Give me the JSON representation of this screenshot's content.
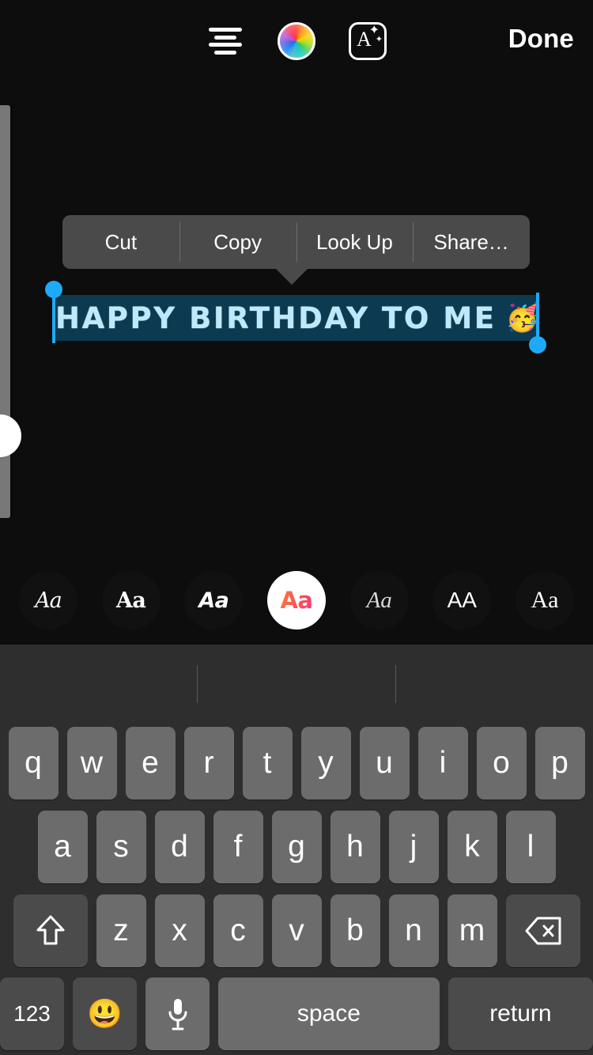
{
  "toolbar": {
    "align_icon": "text-align-center-icon",
    "color_icon": "color-wheel-icon",
    "effects_icon": "text-effects-icon",
    "effects_letter": "A",
    "done_label": "Done"
  },
  "edit_menu": {
    "items": [
      {
        "label": "Cut",
        "name": "cut"
      },
      {
        "label": "Copy",
        "name": "copy"
      },
      {
        "label": "Look Up",
        "name": "look-up"
      },
      {
        "label": "Share…",
        "name": "share"
      }
    ]
  },
  "text_overlay": {
    "text": "HAPPY BIRTHDAY TO ME",
    "emoji": "🥳",
    "text_color": "#bfe9fb",
    "selection_color": "#0c3a50",
    "handle_color": "#1eaaf8",
    "selected": true
  },
  "font_picker": {
    "items": [
      {
        "label": "Aa",
        "style": "script",
        "selected": false
      },
      {
        "label": "Aa",
        "style": "slab-bold",
        "selected": false
      },
      {
        "label": "Aa",
        "style": "bold-italic",
        "selected": false
      },
      {
        "label": "Aa",
        "style": "rounded-gradient",
        "selected": true
      },
      {
        "label": "Aa",
        "style": "serif-italic",
        "selected": false
      },
      {
        "label": "AA",
        "style": "sans-caps",
        "selected": false
      },
      {
        "label": "Aa",
        "style": "serif",
        "selected": false
      }
    ],
    "selected_index": 3,
    "selected_gradient": [
      "#ff7a3d",
      "#f4386f"
    ]
  },
  "keyboard": {
    "predictive_suggestions": [
      "",
      "",
      ""
    ],
    "row1": [
      "q",
      "w",
      "e",
      "r",
      "t",
      "y",
      "u",
      "i",
      "o",
      "p"
    ],
    "row2": [
      "a",
      "s",
      "d",
      "f",
      "g",
      "h",
      "j",
      "k",
      "l"
    ],
    "row3": [
      "z",
      "x",
      "c",
      "v",
      "b",
      "n",
      "m"
    ],
    "shift_icon": "shift-arrow-icon",
    "backspace_icon": "backspace-icon",
    "numbers_label": "123",
    "emoji_icon": "emoji-smiley-icon",
    "mic_icon": "microphone-icon",
    "space_label": "space",
    "return_label": "return"
  }
}
